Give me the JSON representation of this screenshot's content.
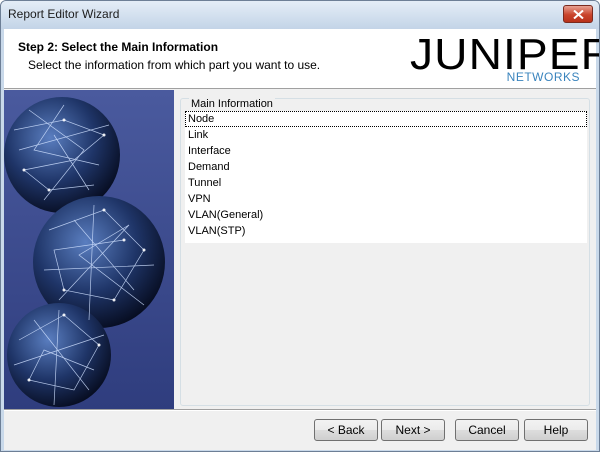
{
  "window": {
    "title": "Report Editor Wizard"
  },
  "header": {
    "step_title": "Step 2: Select the Main Information",
    "step_subtitle": "Select the information from which part you want to use.",
    "logo": {
      "main": "JUNIPER",
      "sub": "NETWORKS"
    }
  },
  "main": {
    "group_label": "Main Information",
    "items": [
      {
        "label": "Node",
        "selected": true
      },
      {
        "label": "Link"
      },
      {
        "label": "Interface"
      },
      {
        "label": "Demand"
      },
      {
        "label": "Tunnel"
      },
      {
        "label": "VPN"
      },
      {
        "label": "VLAN(General)"
      },
      {
        "label": "VLAN(STP)"
      }
    ]
  },
  "buttons": {
    "back": "< Back",
    "next": "Next >",
    "cancel": "Cancel",
    "help": "Help"
  },
  "colors": {
    "side_panel": "#3a4a8c",
    "logo_accent": "#3a84bd",
    "close_button": "#c9442c"
  }
}
